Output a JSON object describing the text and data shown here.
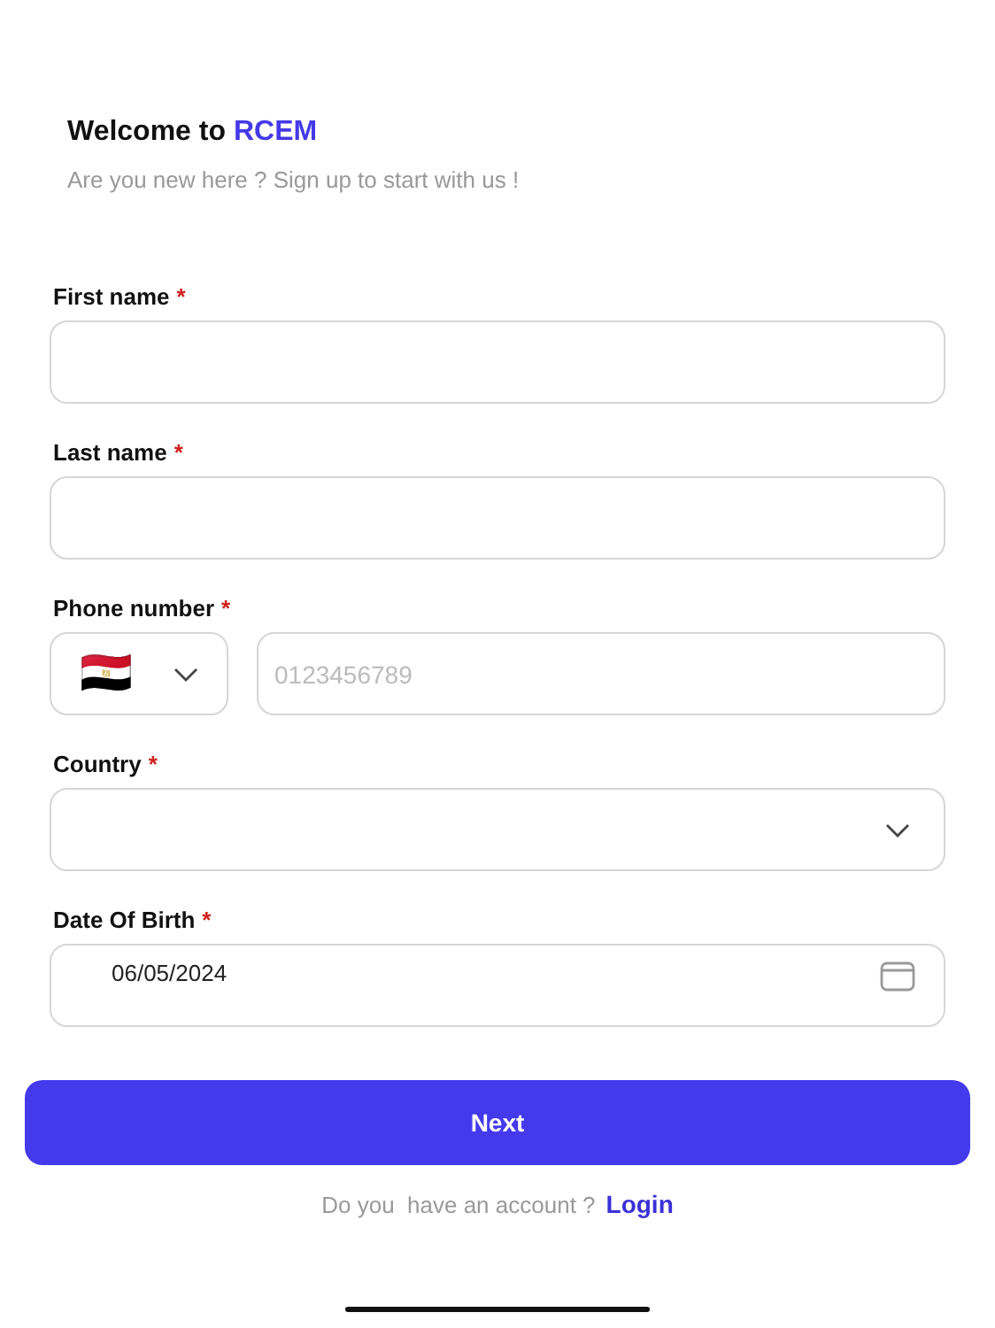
{
  "header": {
    "title": "Welcome to",
    "brand": "RCEM",
    "subtitle": "Are you new here ? Sign up to start with us !"
  },
  "fields": [
    {
      "kind": "text",
      "label": "First name",
      "required": true
    },
    {
      "kind": "text",
      "label": "Last name",
      "required": true
    },
    {
      "kind": "phone",
      "label": "Phone number",
      "required": true,
      "flag": "🇪🇬",
      "placeholder": "0123456789"
    },
    {
      "kind": "select",
      "label": "Country",
      "required": true
    },
    {
      "kind": "date",
      "label": "Date Of Birth",
      "required": true,
      "value": "06/05/2024"
    }
  ],
  "required_mark": "*",
  "next_button": "Next",
  "footer": {
    "prompt": "Do you  have an account ?",
    "link": "Login"
  }
}
